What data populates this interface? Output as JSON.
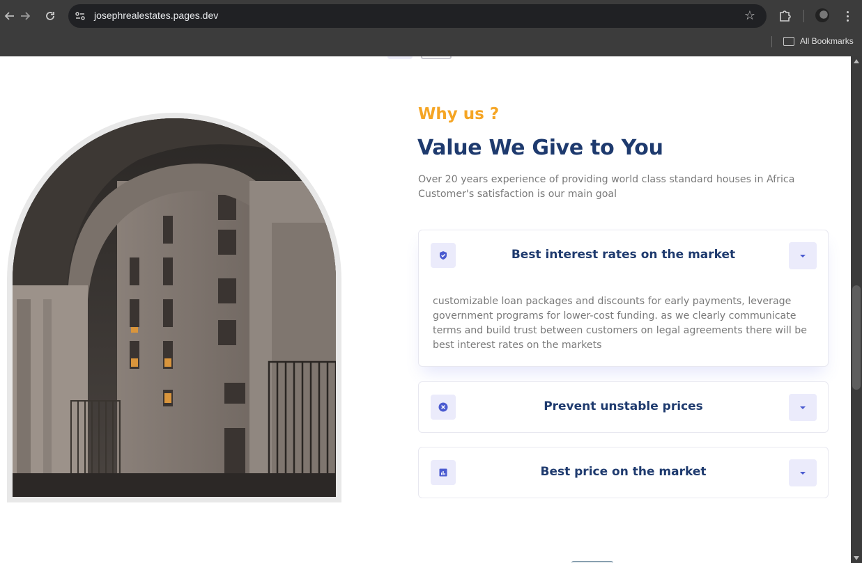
{
  "browser": {
    "url": "josephrealestates.pages.dev",
    "bookmarks_label": "All Bookmarks",
    "icons": {
      "back": "arrow-left-icon",
      "forward": "arrow-right-icon",
      "reload": "reload-icon",
      "site_info": "tune-icon",
      "bookmark": "star-icon",
      "extensions": "puzzle-icon",
      "menu": "kebab-icon",
      "bookmarks_folder": "folder-icon"
    }
  },
  "section": {
    "eyebrow": "Why us ?",
    "heading": "Value We Give to You",
    "description_line1": "Over 20 years experience of providing world class standard houses in Africa",
    "description_line2": "Customer's satisfaction is our main goal"
  },
  "accordion": [
    {
      "title": "Best interest rates on the market",
      "icon": "shield-check-icon",
      "expanded": true,
      "body": "customizable loan packages and discounts for early payments, leverage government programs for lower-cost funding. as we clearly communicate terms and build trust between customers on legal agreements there will be best interest rates on the markets"
    },
    {
      "title": "Prevent unstable prices",
      "icon": "x-circle-icon",
      "expanded": false
    },
    {
      "title": "Best price on the market",
      "icon": "bar-chart-icon",
      "expanded": false
    }
  ],
  "colors": {
    "accent": "#f5a524",
    "heading": "#1e3a6e",
    "icon_bg": "#ebebfb",
    "icon_fg": "#4b5bd0",
    "text_muted": "#7a7a7a"
  }
}
